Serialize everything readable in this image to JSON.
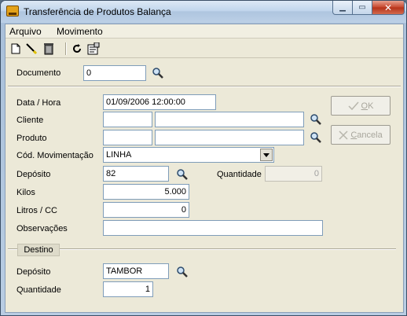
{
  "window": {
    "title": "Transferência de Produtos Balança",
    "minimize": "▁",
    "maximize": "▭",
    "close": "✕"
  },
  "menu": [
    "Arquivo",
    "Movimento"
  ],
  "toolbar": {
    "icons": [
      "new-document-icon",
      "edit-pencil-icon",
      "trash-icon",
      "refresh-icon",
      "properties-icon"
    ]
  },
  "form": {
    "documento": {
      "label": "Documento",
      "value": "0"
    },
    "data_hora": {
      "label": "Data / Hora",
      "value": "01/09/2006 12:00:00"
    },
    "cliente": {
      "label": "Cliente",
      "code": "",
      "name": ""
    },
    "produto": {
      "label": "Produto",
      "code": "",
      "name": ""
    },
    "cod_movimentacao": {
      "label": "Cód. Movimentação",
      "value": "LINHA"
    },
    "deposito": {
      "label": "Depósito",
      "value": "82"
    },
    "quantidade": {
      "label": "Quantidade",
      "value": "0"
    },
    "kilos": {
      "label": "Kilos",
      "value": "5.000"
    },
    "litros": {
      "label": "Litros / CC",
      "value": "0"
    },
    "observacoes": {
      "label": "Observações",
      "value": ""
    }
  },
  "buttons": {
    "ok": {
      "prefix": "",
      "underline": "O",
      "rest": "K"
    },
    "cancela": {
      "underline": "C",
      "rest": "ancela"
    }
  },
  "destino": {
    "section_label": "Destino",
    "deposito": {
      "label": "Depósito",
      "value": "TAMBOR"
    },
    "quantidade": {
      "label": "Quantidade",
      "value": "1"
    }
  },
  "colors": {
    "titlebar": "#c2d6ec",
    "dialog_bg": "#ece9d8",
    "input_border": "#7f9db9",
    "disabled_text": "#a8a69c"
  }
}
